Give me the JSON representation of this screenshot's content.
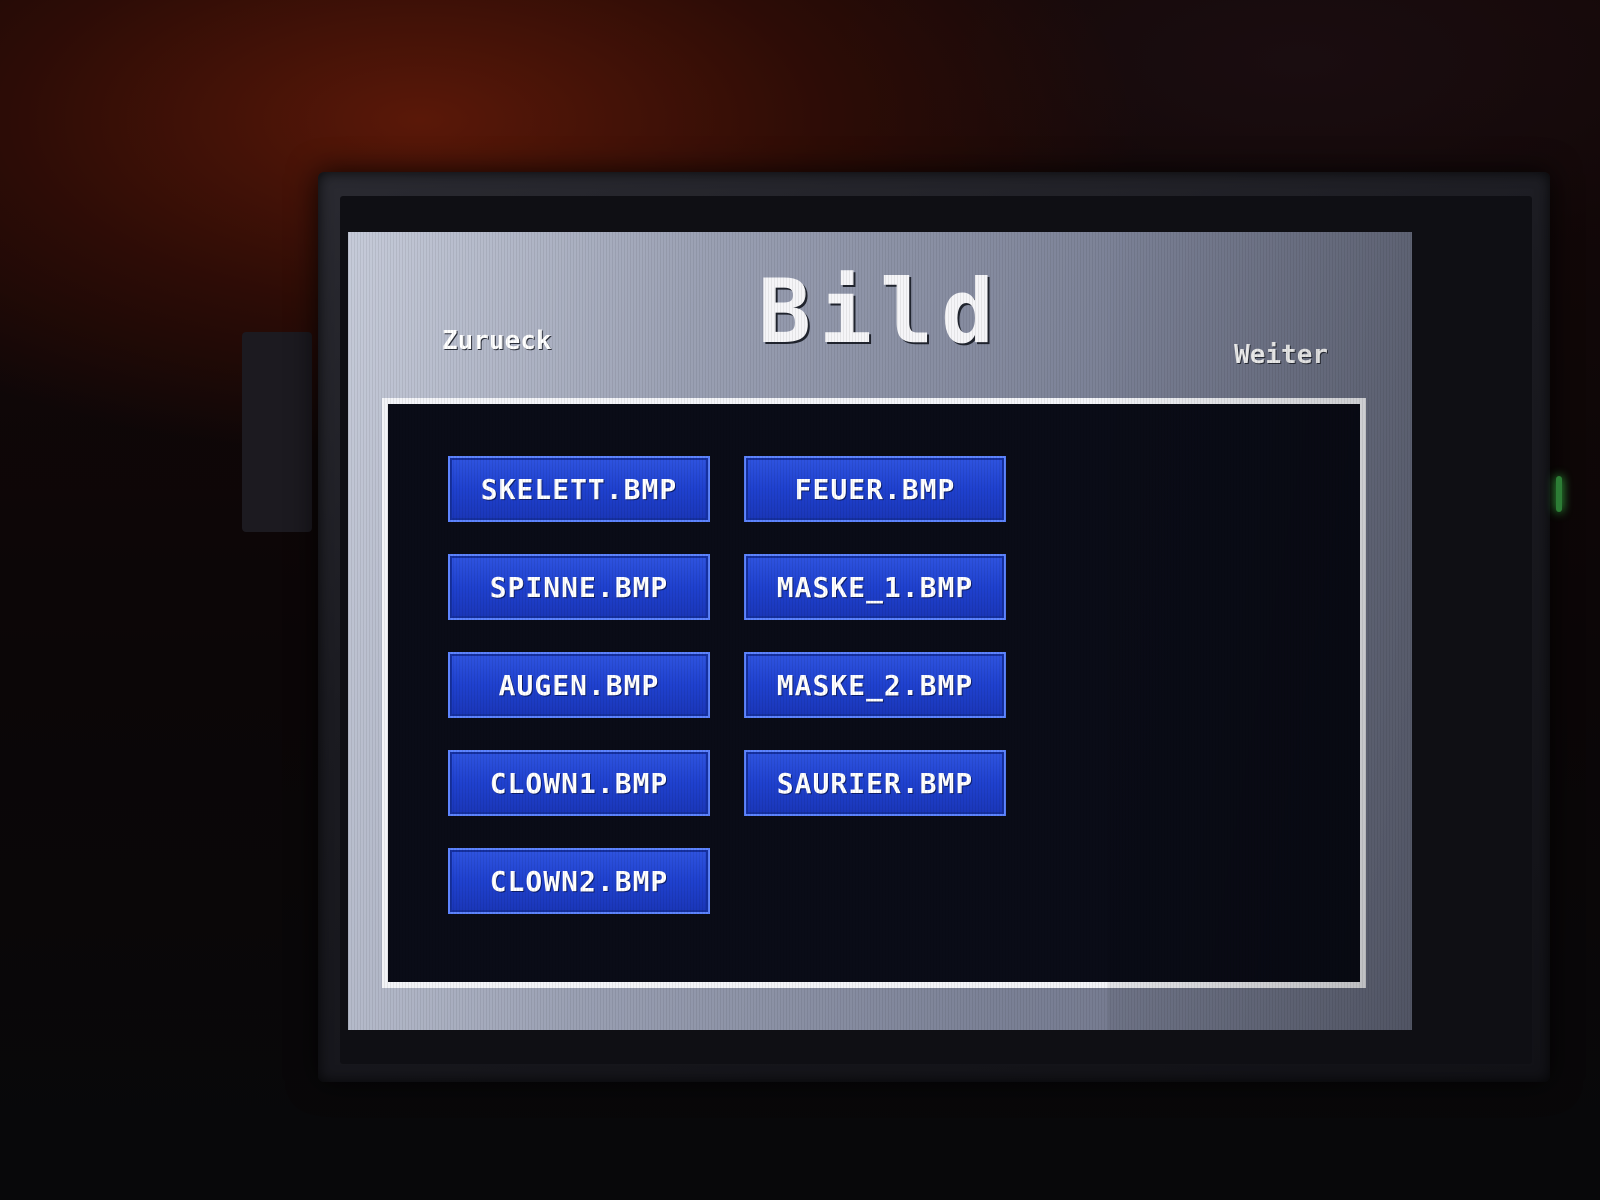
{
  "screen": {
    "title": "Bild",
    "back_label": "Zurueck",
    "next_label": "Weiter"
  },
  "files": [
    "SKELETT.BMP",
    "FEUER.BMP",
    "SPINNE.BMP",
    "MASKE_1.BMP",
    "AUGEN.BMP",
    "MASKE_2.BMP",
    "CLOWN1.BMP",
    "SAURIER.BMP",
    "CLOWN2.BMP"
  ],
  "colors": {
    "screen_background": "#9aa0b3",
    "panel_background": "#0a0c17",
    "panel_border": "#f3f4f8",
    "file_button": "#1f41cf",
    "file_button_border": "#5d84ff",
    "text": "#ffffff"
  }
}
